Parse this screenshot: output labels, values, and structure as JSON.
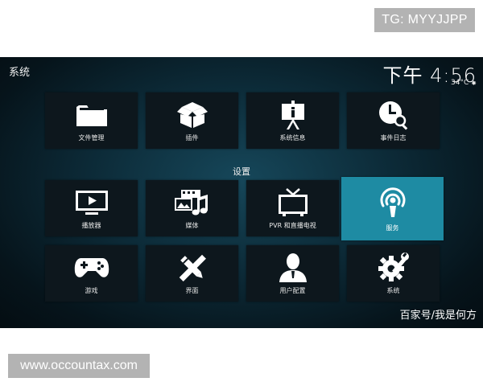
{
  "watermark_top": "TG: MYYJJPP",
  "watermark_bottom": "www.occountax.com",
  "screen": {
    "title": "系统",
    "clock": "下午 4:56",
    "temperature": "34°C",
    "section_label": "设置",
    "credit": "百家号/我是何方",
    "accent_color": "#1e8ba3"
  },
  "top_row": [
    {
      "label": "文件管理",
      "icon": "folder-icon"
    },
    {
      "label": "插件",
      "icon": "addon-box-icon"
    },
    {
      "label": "系统信息",
      "icon": "presentation-info-icon"
    },
    {
      "label": "事件日志",
      "icon": "clock-search-icon"
    }
  ],
  "settings_rows": [
    [
      {
        "label": "播放器",
        "icon": "tv-play-icon"
      },
      {
        "label": "媒体",
        "icon": "media-icon"
      },
      {
        "label": "PVR 和直播电视",
        "icon": "tv-antenna-icon"
      },
      {
        "label": "服务",
        "icon": "broadcast-icon",
        "selected": true
      }
    ],
    [
      {
        "label": "游戏",
        "icon": "gamepad-icon"
      },
      {
        "label": "界面",
        "icon": "pencil-ruler-icon"
      },
      {
        "label": "用户配置",
        "icon": "user-profile-icon"
      },
      {
        "label": "系统",
        "icon": "gear-wrench-icon"
      }
    ]
  ]
}
